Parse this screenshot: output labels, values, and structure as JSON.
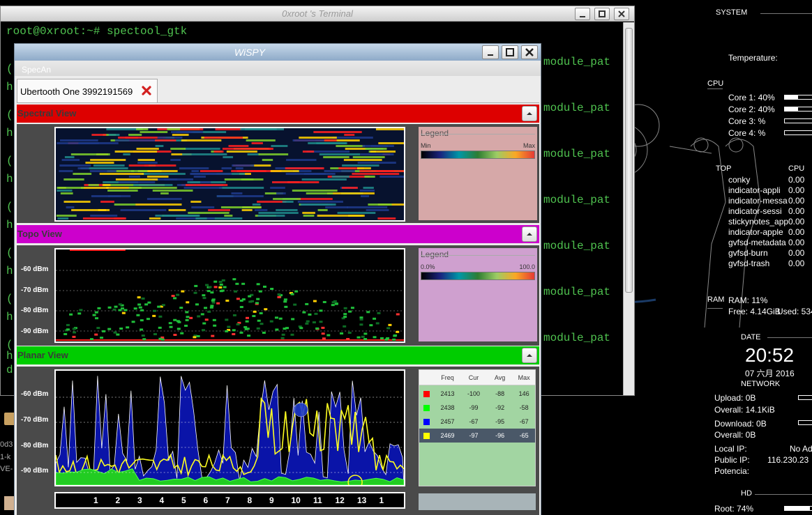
{
  "terminal": {
    "title": "0xroot 's Terminal",
    "prompt": "root@0xroot:~# spectool_gtk",
    "left_fragments": [
      "(",
      "h",
      "(",
      "h",
      "(",
      "h",
      "(",
      "h",
      "(",
      "h",
      "(",
      "h",
      "(",
      "h",
      "d"
    ],
    "module_text": "module_pat"
  },
  "wispy": {
    "title": "WiSPY",
    "menu": "SpecAn",
    "tab_label": "Ubertooth One 3992191569",
    "sections": {
      "spectral": {
        "title": "Spectral View",
        "legend_title": "Legend",
        "legend_min": "Min",
        "legend_max": "Max",
        "color": "#dd0000"
      },
      "topo": {
        "title": "Topo View",
        "legend_title": "Legend",
        "legend_min": "0.0%",
        "legend_max": "100.0",
        "color": "#cc00cc",
        "y_labels": [
          "-60 dBm",
          "-70 dBm",
          "-80 dBm",
          "-90 dBm"
        ]
      },
      "planar": {
        "title": "Planar View",
        "color": "#00cc00",
        "y_labels": [
          "-60 dBm",
          "-70 dBm",
          "-80 dBm",
          "-90 dBm"
        ],
        "table_headers": [
          "Freq",
          "Cur",
          "Avg",
          "Max"
        ],
        "rows": [
          {
            "color": "#ff0000",
            "freq": "2413",
            "cur": "-100",
            "avg": "-88",
            "max": "146"
          },
          {
            "color": "#00ff00",
            "freq": "2438",
            "cur": "-99",
            "avg": "-92",
            "max": "-58"
          },
          {
            "color": "#0000ff",
            "freq": "2457",
            "cur": "-67",
            "avg": "-95",
            "max": "-67"
          },
          {
            "color": "#ffff00",
            "freq": "2469",
            "cur": "-97",
            "avg": "-96",
            "max": "-65"
          }
        ],
        "channels": [
          "1",
          "2",
          "3",
          "4",
          "5",
          "6",
          "7",
          "8",
          "9",
          "10",
          "11",
          "12",
          "13",
          "1"
        ]
      }
    }
  },
  "desktop": {
    "icon_labels": [
      "0d3",
      "1-k",
      "VE-"
    ]
  },
  "conky": {
    "system": "SYSTEM",
    "temperature": "Temperature:",
    "cpu_label": "CPU",
    "cores": [
      {
        "label": "Core 1: 40%",
        "level": 0.4
      },
      {
        "label": "Core 2: 40%",
        "level": 0.4
      },
      {
        "label": "Core 3: %",
        "level": 0
      },
      {
        "label": "Core 4: %",
        "level": 0
      }
    ],
    "top_header": "TOP",
    "cpu_header": "CPU",
    "processes": [
      {
        "name": "conky",
        "cpu": "0.00"
      },
      {
        "name": "indicator-appli",
        "cpu": "0.00"
      },
      {
        "name": "indicator-messa",
        "cpu": "0.00"
      },
      {
        "name": "indicator-sessi",
        "cpu": "0.00"
      },
      {
        "name": "stickynotes_app",
        "cpu": "0.00"
      },
      {
        "name": "indicator-apple",
        "cpu": "0.00"
      },
      {
        "name": "gvfsd-metadata",
        "cpu": "0.00"
      },
      {
        "name": "gvfsd-burn",
        "cpu": "0.00"
      },
      {
        "name": "gvfsd-trash",
        "cpu": "0.00"
      }
    ],
    "ram_label": "RAM",
    "ram": "RAM: 11%",
    "ram_free": "Free: 4.14GiB",
    "ram_used": "Used: 534",
    "date_label": "DATE",
    "time": "20:52",
    "date": "07 六月 2016",
    "network": "NETWORK",
    "upload": "Upload: 0B",
    "overall1": "Overall: 14.1KiB",
    "download": "Download: 0B",
    "overall2": "Overall: 0B",
    "local_ip_label": "Local IP:",
    "local_ip": "No Ad",
    "public_ip_label": "Public IP:",
    "public_ip": "116.230.23",
    "potencia": "Potencia:",
    "hd": "HD",
    "root": "Root: 74%",
    "root_level": 0.74
  }
}
